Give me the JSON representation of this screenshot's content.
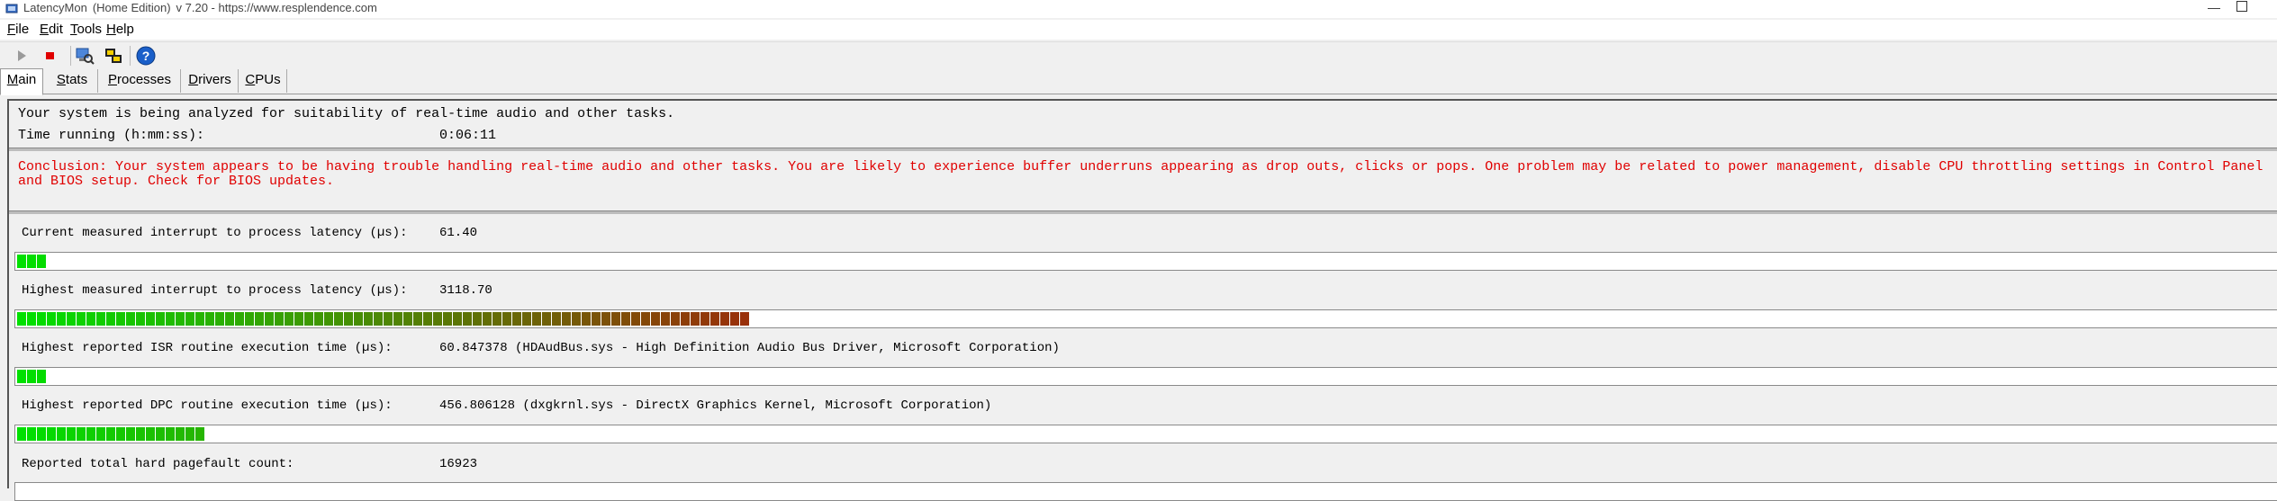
{
  "window": {
    "app_name": "LatencyMon",
    "edition": "(Home Edition)",
    "version_url": "v 7.20 - https://www.resplendence.com"
  },
  "menu": [
    {
      "label": "File",
      "accel": "F",
      "rest": "ile"
    },
    {
      "label": "Edit",
      "accel": "E",
      "rest": "dit"
    },
    {
      "label": "Tools",
      "accel": "T",
      "rest": "ools"
    },
    {
      "label": "Help",
      "accel": "H",
      "rest": "elp"
    }
  ],
  "toolbar": {
    "icons": [
      "play-icon",
      "stop-icon",
      "search-computer-icon",
      "windows-icon",
      "help-icon"
    ]
  },
  "tabs": [
    {
      "label": "Main",
      "accel": "M",
      "rest": "ain",
      "active": true
    },
    {
      "label": "Stats",
      "accel": "S",
      "rest": "tats",
      "active": false
    },
    {
      "label": "Processes",
      "accel": "P",
      "rest": "rocesses",
      "active": false
    },
    {
      "label": "Drivers",
      "accel": "D",
      "rest": "rivers",
      "active": false
    },
    {
      "label": "CPUs",
      "accel": "C",
      "rest": "PUs",
      "active": false
    }
  ],
  "status": {
    "analyzing": "Your system is being analyzed for suitability of real-time audio and other tasks.",
    "time_label": "Time running (h:mm:ss):",
    "time_value": "0:06:11",
    "conclusion": "Conclusion: Your system appears to be having trouble handling real-time audio and other tasks. You are likely to experience buffer underruns appearing as drop outs, clicks or pops. One problem may be related to power management, disable CPU throttling settings in Control Panel and BIOS setup. Check for BIOS updates."
  },
  "metrics": [
    {
      "label": "Current measured interrupt to process latency (µs):",
      "value": "61.40",
      "level": 0.012
    },
    {
      "label": "Highest measured interrupt to process latency (µs):",
      "value": "3118.70",
      "level": 0.325
    },
    {
      "label": "Highest reported ISR routine execution time (µs):",
      "value": "60.847378  (HDAudBus.sys - High Definition Audio Bus Driver, Microsoft Corporation)",
      "level": 0.012
    },
    {
      "label": "Highest reported DPC routine execution time (µs):",
      "value": "456.806128  (dxgkrnl.sys - DirectX Graphics Kernel, Microsoft Corporation)",
      "level": 0.083
    },
    {
      "label": "Reported total hard pagefault count:",
      "value": "16923",
      "level": null
    }
  ],
  "colors": {
    "conclusion_text": "#e00000",
    "meter_low": "#00e000",
    "meter_high": "#9e2a0a"
  }
}
